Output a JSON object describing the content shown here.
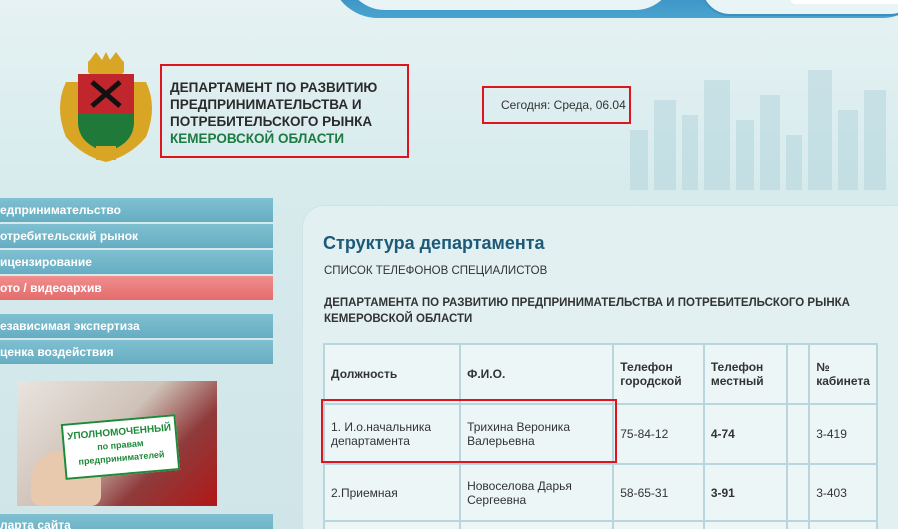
{
  "header": {
    "title_lines": [
      "ДЕПАРТАМЕНТ ПО РАЗВИТИЮ",
      "ПРЕДПРИНИМАТЕЛЬСТВА И",
      "ПОТРЕБИТЕЛЬСКОГО РЫНКА"
    ],
    "title_region": "КЕМЕРОВСКОЙ ОБЛАСТИ",
    "date_text": "Сегодня: Среда, 06.04",
    "logo_icon": "kemerovo-coat-of-arms-icon"
  },
  "sidebar": {
    "items": [
      {
        "label": "едпринимательство"
      },
      {
        "label": "отребительский рынок"
      },
      {
        "label": "ицензирование"
      },
      {
        "label": "ото / видеоархив"
      },
      {
        "label": "езависимая экспертиза"
      },
      {
        "label": "ценка воздействия"
      }
    ],
    "banner": {
      "line1": "УПОЛНОМОЧЕННЫЙ",
      "line2": "по правам",
      "line3": "предпринимателей"
    },
    "bottom_item": "ларта сайта"
  },
  "main": {
    "heading": "Структура департамента",
    "subheading": "СПИСОК ТЕЛЕФОНОВ СПЕЦИАЛИСТОВ",
    "department": "ДЕПАРТАМЕНТА ПО РАЗВИТИЮ ПРЕДПРИНИМАТЕЛЬСТВА И ПОТРЕБИТЕЛЬСКОГО РЫНКА КЕМЕРОВСКОЙ ОБЛАСТИ",
    "table": {
      "headers": [
        "Должность",
        "Ф.И.О.",
        "Телефон городской",
        "Телефон местный",
        "",
        "№ кабинета"
      ],
      "rows": [
        [
          "1.       И.о.начальника департамента",
          "Трихина Вероника Валерьевна",
          "75-84-12",
          "4-74",
          "",
          "3-419"
        ],
        [
          "2.Приемная",
          "Новоселова Дарья Сергеевна",
          "58-65-31",
          "3-91",
          "",
          "3-403"
        ],
        [
          "",
          "",
          "",
          "",
          "",
          ""
        ]
      ]
    }
  },
  "colors": {
    "highlight": "#e0141e",
    "sidebar": "#66adc2",
    "sidebar_active": "#e46c6c",
    "heading": "#1c5a78",
    "region_text": "#1d7a42"
  }
}
